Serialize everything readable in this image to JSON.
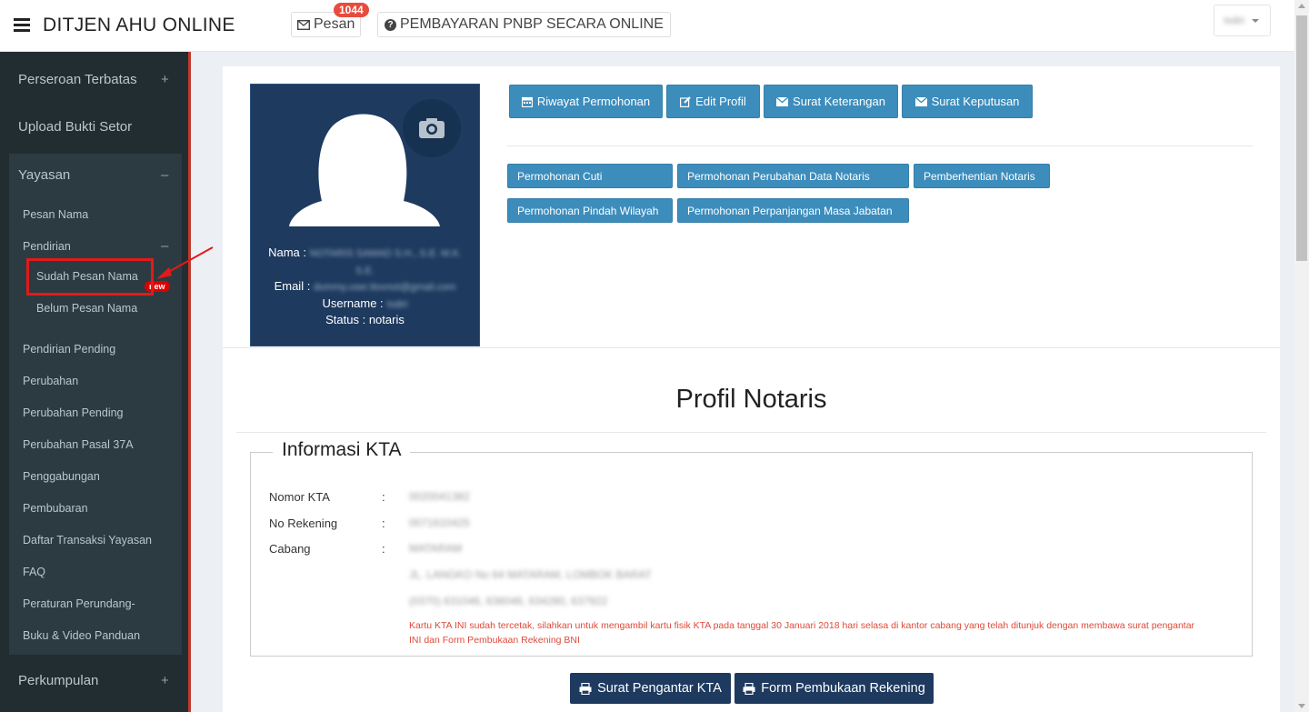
{
  "header": {
    "brand": "DITJEN AHU ONLINE",
    "pesan_label": "Pesan",
    "pesan_count": "1044",
    "pnbp_label": "PEMBAYARAN PNBP SECARA ONLINE",
    "user_name": "Isdiri"
  },
  "sidebar": {
    "perseroan": "Perseroan Terbatas",
    "upload": "Upload Bukti Setor",
    "yayasan": "Yayasan",
    "yayasan_items": {
      "pesan_nama": "Pesan Nama",
      "pendirian": "Pendirian",
      "sudah_pesan_nama": "Sudah Pesan Nama",
      "belum_pesan_nama": "Belum Pesan Nama",
      "pendirian_pending": "Pendirian Pending",
      "new_badge": "new",
      "perubahan": "Perubahan",
      "perubahan_pending": "Perubahan Pending",
      "perubahan_pasal": "Perubahan Pasal 37A",
      "penggabungan": "Penggabungan",
      "pembubaran": "Pembubaran",
      "daftar_transaksi": "Daftar Transaksi Yayasan",
      "faq": "FAQ",
      "peraturan": "Peraturan Perundang-",
      "buku_video": "Buku & Video Panduan"
    },
    "perkumpulan": "Perkumpulan",
    "plus": "+",
    "minus": "–"
  },
  "profile": {
    "nama_label": "Nama :",
    "nama_value": "NOTARIS SAMAD S.H., S.E. M.K.",
    "nama_value_2": "S.E.",
    "email_label": "Email :",
    "email_value": "dummy.user.ttovnot@gmail.com",
    "username_label": "Username :",
    "username_value": "Isdiri",
    "status_label": "Status :",
    "status_value": "notaris"
  },
  "actions": {
    "riwayat": "Riwayat Permohonan",
    "edit_profil": "Edit Profil",
    "surat_keterangan": "Surat Keterangan",
    "surat_keputusan": "Surat Keputusan",
    "cuti": "Permohonan Cuti",
    "perubahan_data": "Permohonan Perubahan Data Notaris",
    "pemberhentian": "Pemberhentian Notaris",
    "pindah_wilayah": "Permohonan Pindah Wilayah",
    "perpanjangan": "Permohonan Perpanjangan Masa Jabatan"
  },
  "main": {
    "title": "Profil Notaris",
    "legend": "Informasi KTA",
    "nomor_kta_label": "Nomor KTA",
    "no_rekening_label": "No Rekening",
    "cabang_label": "Cabang",
    "colon": ":",
    "nomor_kta_value": "0020041382",
    "no_rekening_value": "0071610425",
    "cabang_value": "MATARAM",
    "address_1": "JL. LANGKO No 64 MATARAM, LOMBOK BARAT",
    "address_2": "(0370) 631046, 636046, 634280, 637922",
    "notice": "Kartu KTA INI sudah tercetak, silahkan untuk mengambil kartu fisik KTA pada tanggal 30 Januari 2018 hari selasa di kantor cabang yang telah ditunjuk dengan membawa surat pengantar INI dan Form Pembukaan Rekening BNI",
    "surat_pengantar": "Surat Pengantar KTA",
    "form_pembukaan": "Form Pembukaan Rekening"
  },
  "colors": {
    "sidebar_bg": "#222d32",
    "card_bg": "#1e3a5f",
    "button_blue": "#3c8dbc",
    "highlight_red": "#e21a1a"
  }
}
